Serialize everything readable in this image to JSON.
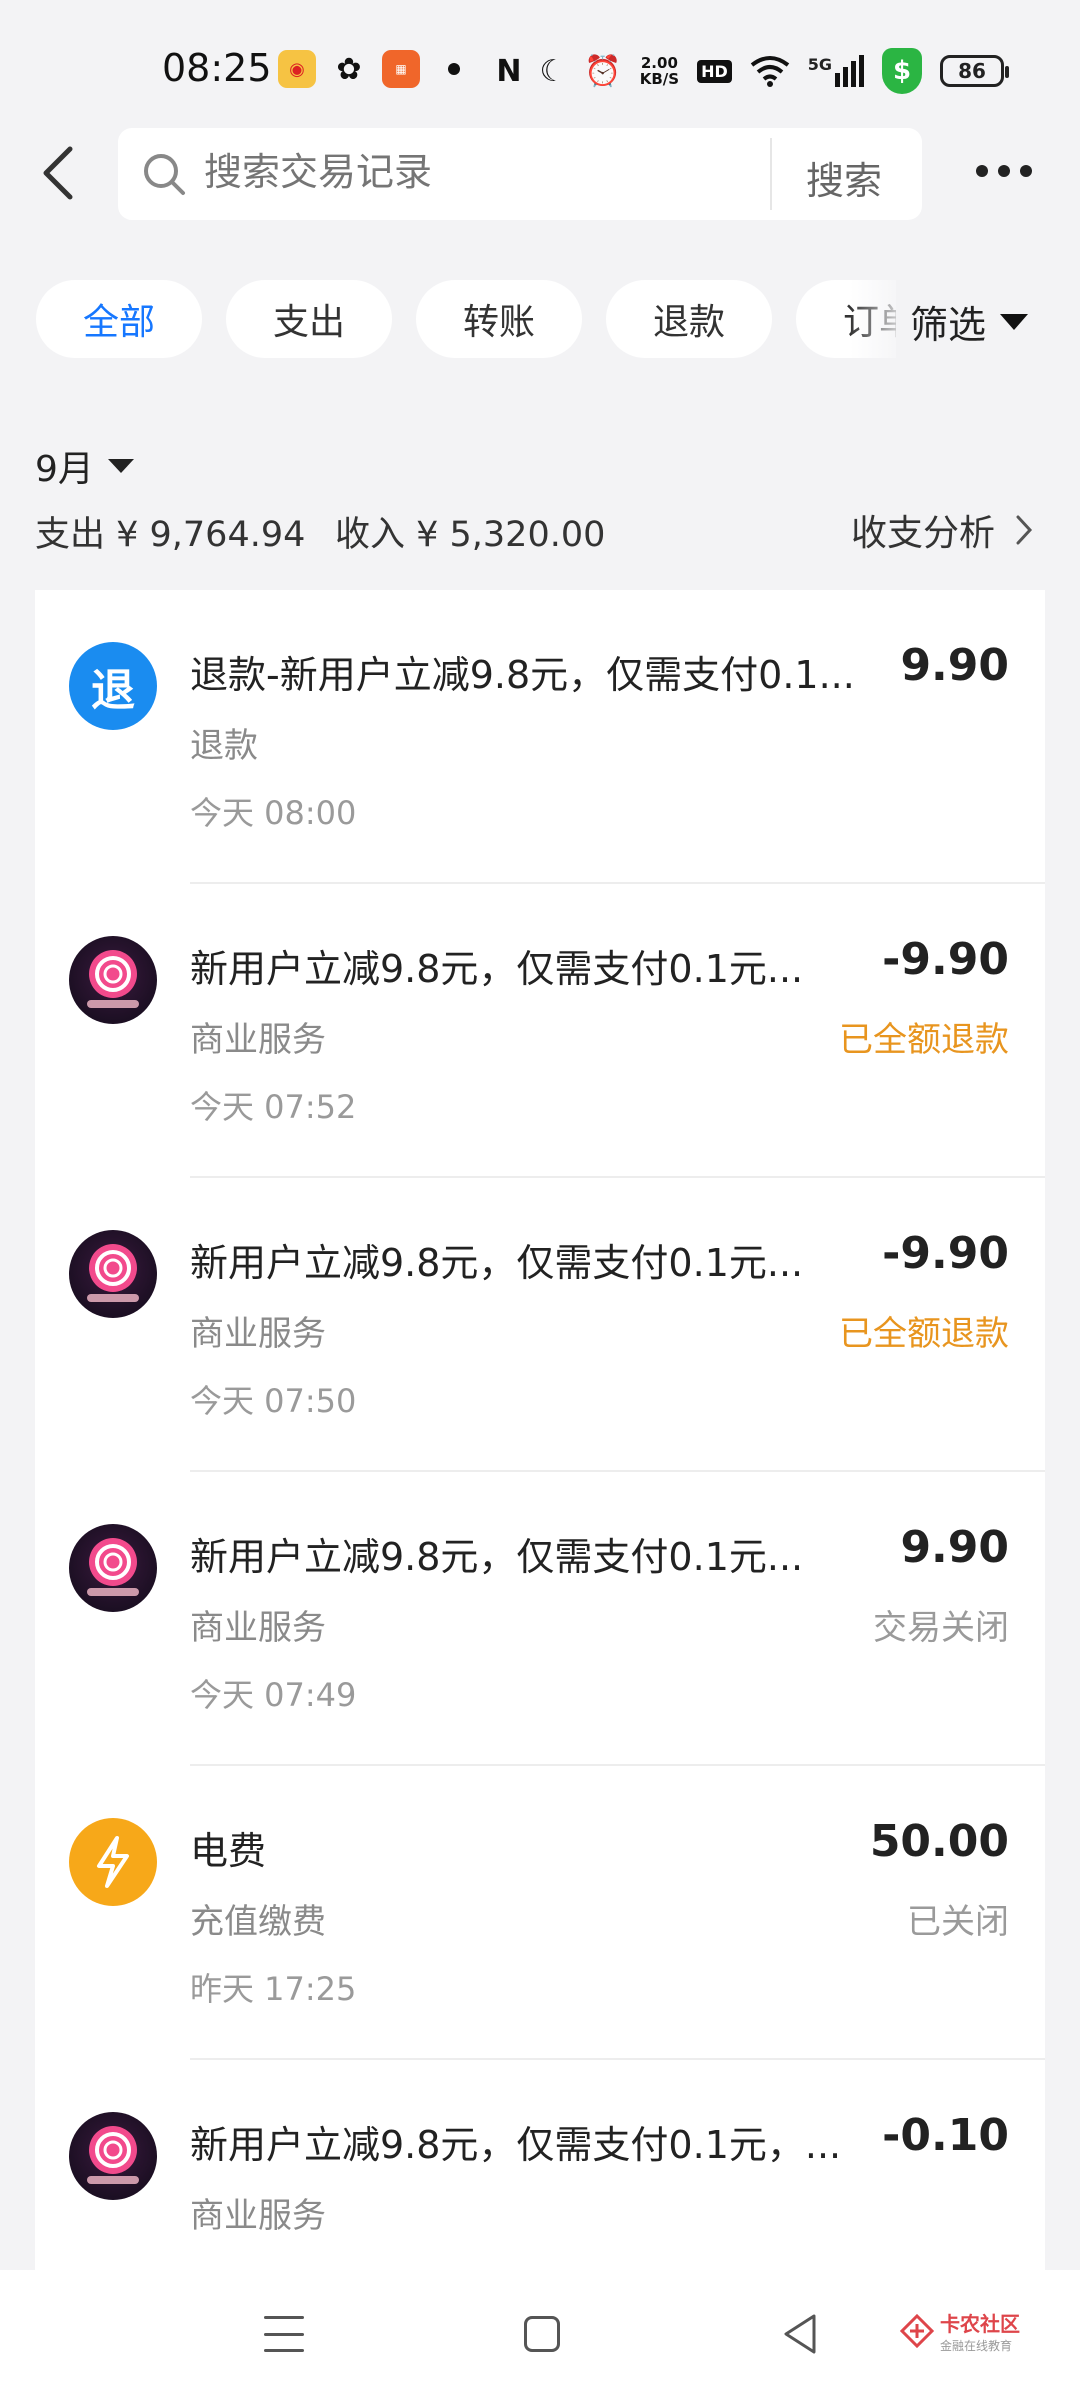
{
  "status_bar": {
    "time": "08:25",
    "net_speed_value": "2.00",
    "net_speed_unit": "KB/S",
    "hd": "HD",
    "signal": "5G",
    "battery": "86"
  },
  "search": {
    "placeholder": "搜索交易记录",
    "button_label": "搜索"
  },
  "filters": {
    "chips": [
      "全部",
      "支出",
      "转账",
      "退款",
      "订单"
    ],
    "active": "全部",
    "filter_label": "筛选"
  },
  "summary": {
    "month": "9月",
    "expense": "支出 ¥ 9,764.94",
    "income": "收入 ¥ 5,320.00",
    "analysis_label": "收支分析"
  },
  "transactions": [
    {
      "icon": "refund-icon",
      "icon_text": "退",
      "title": "退款-新用户立减9.8元，仅需支付0.1...",
      "category": "退款",
      "time": "今天 08:00",
      "amount": "9.90",
      "status": ""
    },
    {
      "icon": "lollipop-merchant-icon",
      "title": "新用户立减9.8元，仅需支付0.1元...",
      "category": "商业服务",
      "time": "今天 07:52",
      "amount": "-9.90",
      "status": "已全额退款",
      "status_color": "#e8951f"
    },
    {
      "icon": "lollipop-merchant-icon",
      "title": "新用户立减9.8元，仅需支付0.1元...",
      "category": "商业服务",
      "time": "今天 07:50",
      "amount": "-9.90",
      "status": "已全额退款",
      "status_color": "#e8951f"
    },
    {
      "icon": "lollipop-merchant-icon",
      "title": "新用户立减9.8元，仅需支付0.1元...",
      "category": "商业服务",
      "time": "今天 07:49",
      "amount": "9.90",
      "status": "交易关闭"
    },
    {
      "icon": "lightning-icon",
      "title": "电费",
      "category": "充值缴费",
      "time": "昨天 17:25",
      "amount": "50.00",
      "status": "已关闭"
    },
    {
      "icon": "lollipop-merchant-icon",
      "title": "新用户立减9.8元，仅需支付0.1元，...",
      "category": "商业服务",
      "time": "",
      "amount": "-0.10",
      "status": ""
    }
  ],
  "watermark": {
    "name": "卡农社区",
    "tagline": "金融在线教育"
  }
}
